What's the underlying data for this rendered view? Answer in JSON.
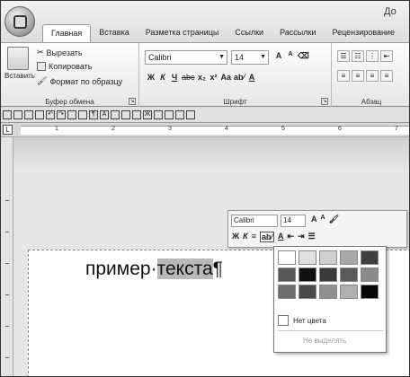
{
  "window": {
    "title_partial": "До"
  },
  "tabs": [
    "Главная",
    "Вставка",
    "Разметка страницы",
    "Ссылки",
    "Рассылки",
    "Рецензирование"
  ],
  "active_tab": 0,
  "clipboard": {
    "paste_label": "Вставить",
    "cut_label": "Вырезать",
    "copy_label": "Копировать",
    "format_painter_label": "Формат по образцу",
    "group_label": "Буфер обмена"
  },
  "font": {
    "name": "Calibri",
    "size": "14",
    "group_label": "Шрифт",
    "grow_glyph": "A",
    "shrink_glyph": "A",
    "bold": "Ж",
    "italic": "К",
    "underline": "Ч",
    "strike": "abc",
    "subscript": "x₂",
    "superscript": "x²",
    "case": "Aa",
    "highlight": "ab⁄",
    "color": "A"
  },
  "paragraph": {
    "group_label": "Абзац"
  },
  "ruler": {
    "numbers": [
      "1",
      "2",
      "3",
      "4",
      "5",
      "6",
      "7"
    ]
  },
  "document": {
    "text_before": "пример·",
    "text_selected": "текста",
    "pilcrow": "¶"
  },
  "mini_toolbar": {
    "font": "Calibri",
    "size": "14",
    "bold": "Ж",
    "italic": "К",
    "align": "≡",
    "highlight": "ab⁄",
    "color": "A"
  },
  "highlight_menu": {
    "swatch_colors": [
      "#ffffff",
      "#e0e0e0",
      "#cfcfcf",
      "#a7a7a7",
      "#3f3f3f",
      "#595959",
      "#111111",
      "#3a3a3a",
      "#5a5a5a",
      "#8a8a8a",
      "#6d6d6d",
      "#4a4a4a",
      "#909090",
      "#b0b0b0",
      "#070707"
    ],
    "no_color_label": "Нет цвета",
    "stop_highlight_label": "Не выделять"
  }
}
